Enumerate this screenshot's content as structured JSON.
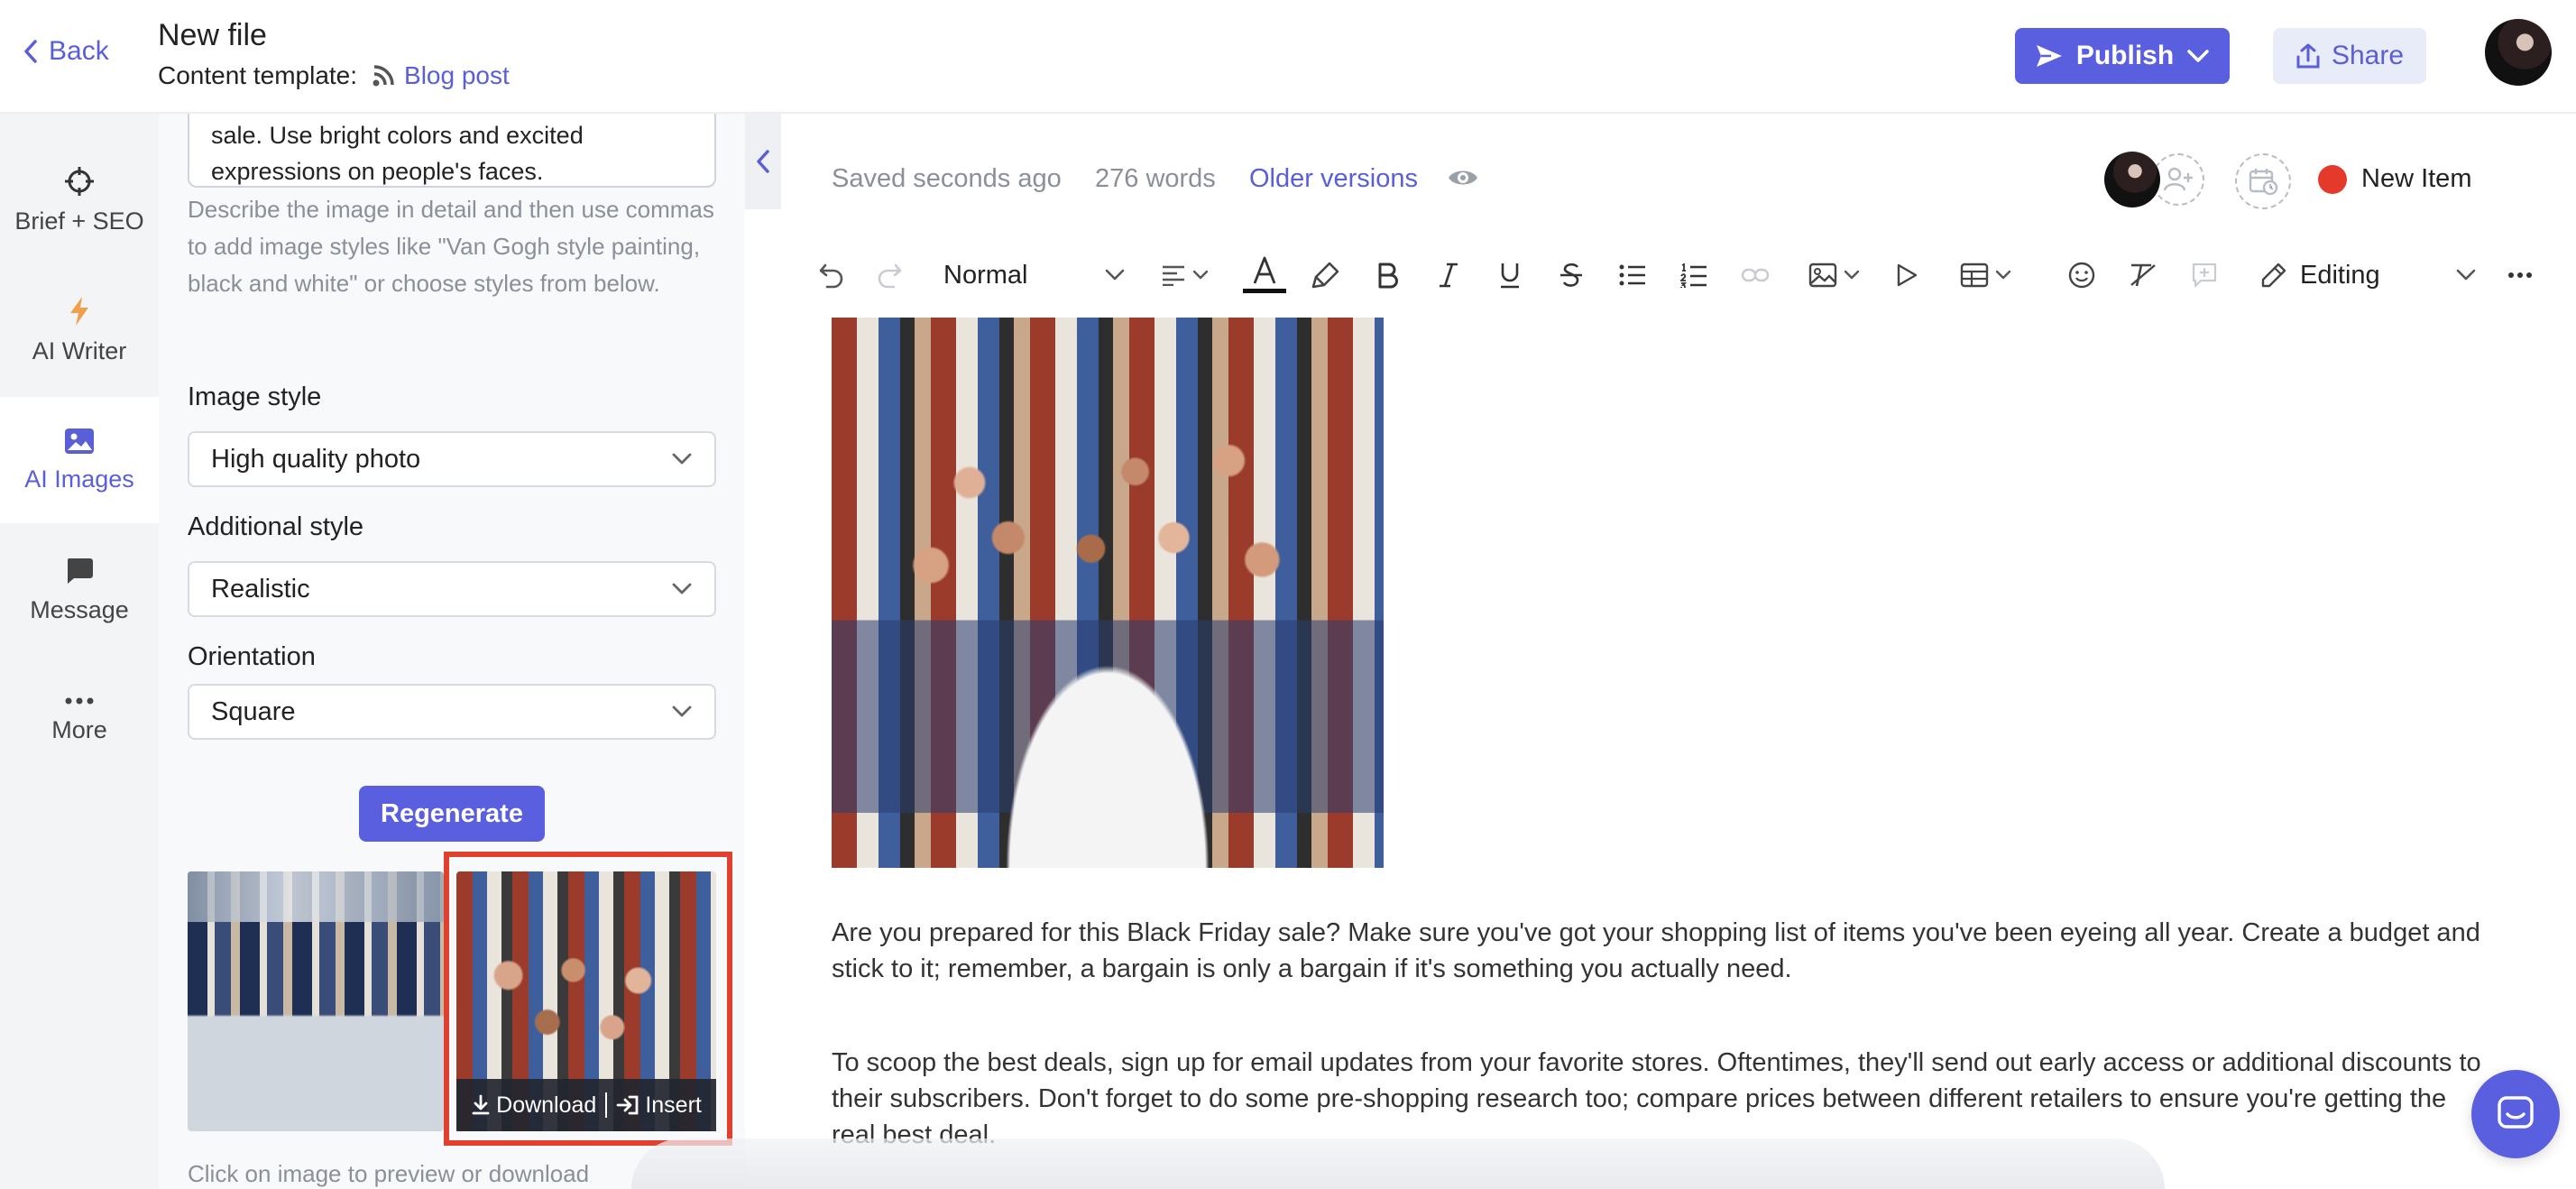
{
  "header": {
    "back_label": "Back",
    "file_title": "New file",
    "template_label": "Content template:",
    "template_name": "Blog post",
    "publish_label": "Publish",
    "share_label": "Share"
  },
  "rail": {
    "items": [
      {
        "label": "Brief + SEO",
        "icon": "crosshair-icon"
      },
      {
        "label": "AI Writer",
        "icon": "lightning-icon"
      },
      {
        "label": "AI Images",
        "icon": "image-icon",
        "active": true
      },
      {
        "label": "Message",
        "icon": "message-icon"
      },
      {
        "label": "More",
        "icon": "more-dots-icon"
      }
    ]
  },
  "panel": {
    "prompt_line1": "sale. Use bright colors and excited",
    "prompt_line2": "expressions on people's faces.",
    "prompt_hint": "Describe the image in detail and then use commas to add image styles like \"Van Gogh style painting, black and white\" or choose styles from below.",
    "image_style_label": "Image style",
    "image_style_value": "High quality photo",
    "additional_style_label": "Additional style",
    "additional_style_value": "Realistic",
    "orientation_label": "Orientation",
    "orientation_value": "Square",
    "regenerate_label": "Regenerate",
    "download_label": "Download",
    "insert_label": "Insert",
    "caption": "Click on image to preview or download"
  },
  "editor": {
    "saved_status": "Saved seconds ago",
    "word_count": "276 words",
    "older_versions": "Older versions",
    "new_item_label": "New Item",
    "block_type": "Normal",
    "mode_label": "Editing",
    "paragraph1": "Are you prepared for this Black Friday sale? Make sure you've got your shopping list of items you've been eyeing all year. Create a budget and stick to it; remember, a bargain is only a bargain if it's something you actually need.",
    "paragraph2": "To scoop the best deals, sign up for email updates from your favorite stores. Oftentimes, they'll send out early access or additional discounts to their subscribers. Don't forget to do some pre-shopping research too; compare prices between different retailers to ensure you're getting the real best deal."
  },
  "colors": {
    "accent": "#5a5fe0",
    "selection_border": "#e0402e",
    "status_dot": "#e5392b"
  }
}
